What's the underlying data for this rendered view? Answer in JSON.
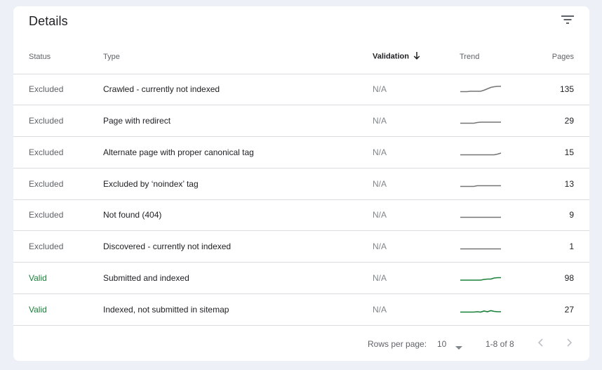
{
  "card": {
    "title": "Details",
    "filter_icon": "filter-icon"
  },
  "table": {
    "headers": {
      "status": "Status",
      "type": "Type",
      "validation": "Validation",
      "trend": "Trend",
      "pages": "Pages"
    },
    "sort_icon": "arrow-down-icon",
    "rows": [
      {
        "status": "Excluded",
        "type": "Crawled - currently not indexed",
        "validation": "N/A",
        "pages": "135",
        "trend_color": "#757575",
        "trend": [
          0.15,
          0.15,
          0.15,
          0.2,
          0.2,
          0.2,
          0.2,
          0.35,
          0.55,
          0.75,
          0.85,
          0.9,
          0.9
        ]
      },
      {
        "status": "Excluded",
        "type": "Page with redirect",
        "validation": "N/A",
        "pages": "29",
        "trend_color": "#757575",
        "trend": [
          0.15,
          0.15,
          0.15,
          0.15,
          0.15,
          0.25,
          0.3,
          0.3,
          0.3,
          0.3,
          0.3,
          0.3,
          0.3
        ]
      },
      {
        "status": "Excluded",
        "type": "Alternate page with proper canonical tag",
        "validation": "N/A",
        "pages": "15",
        "trend_color": "#757575",
        "trend": [
          0.15,
          0.15,
          0.15,
          0.15,
          0.15,
          0.15,
          0.15,
          0.15,
          0.15,
          0.15,
          0.15,
          0.25,
          0.4
        ]
      },
      {
        "status": "Excluded",
        "type": "Excluded by ‘noindex’ tag",
        "validation": "N/A",
        "pages": "13",
        "trend_color": "#757575",
        "trend": [
          0.15,
          0.15,
          0.15,
          0.15,
          0.15,
          0.25,
          0.25,
          0.25,
          0.25,
          0.25,
          0.25,
          0.25,
          0.25
        ]
      },
      {
        "status": "Excluded",
        "type": "Not found (404)",
        "validation": "N/A",
        "pages": "9",
        "trend_color": "#757575",
        "trend": [
          0.15,
          0.15,
          0.15,
          0.15,
          0.15,
          0.15,
          0.15,
          0.15,
          0.15,
          0.15,
          0.15,
          0.15,
          0.15
        ]
      },
      {
        "status": "Excluded",
        "type": "Discovered - currently not indexed",
        "validation": "N/A",
        "pages": "1",
        "trend_color": "#757575",
        "trend": [
          0.15,
          0.15,
          0.15,
          0.15,
          0.15,
          0.15,
          0.15,
          0.15,
          0.15,
          0.15,
          0.15,
          0.15,
          0.15
        ]
      },
      {
        "status": "Valid",
        "type": "Submitted and indexed",
        "validation": "N/A",
        "pages": "98",
        "trend_color": "#188038",
        "trend": [
          0.2,
          0.2,
          0.2,
          0.2,
          0.2,
          0.2,
          0.2,
          0.3,
          0.35,
          0.35,
          0.5,
          0.55,
          0.55
        ]
      },
      {
        "status": "Valid",
        "type": "Indexed, not submitted in sitemap",
        "validation": "N/A",
        "pages": "27",
        "trend_color": "#188038",
        "trend": [
          0.15,
          0.15,
          0.15,
          0.15,
          0.15,
          0.2,
          0.15,
          0.3,
          0.2,
          0.35,
          0.25,
          0.2,
          0.2
        ]
      }
    ]
  },
  "footer": {
    "rows_per_page_label": "Rows per page:",
    "rows_per_page_value": "10",
    "range": "1-8 of 8",
    "prev_icon": "chevron-left-icon",
    "next_icon": "chevron-right-icon"
  },
  "colors": {
    "valid": "#188038",
    "excluded": "#5f6368",
    "background": "#eef0f7"
  }
}
